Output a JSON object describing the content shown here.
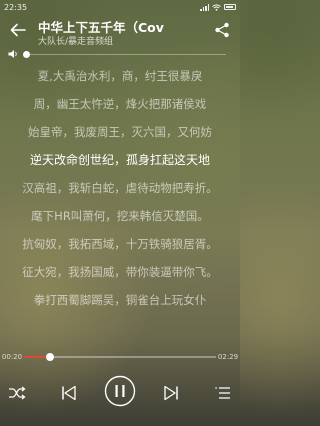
{
  "status": {
    "time": "22:35"
  },
  "header": {
    "title": "中华上下五千年（Cov",
    "artist": "大队长/暴走音频组"
  },
  "volume": {
    "level": 0.0
  },
  "lyrics": [
    "夏,大禹治水利，商，纣王很暴戾",
    "周，幽王太忤逆，烽火把那诸侯戏",
    "始皇帝，我废周王，灭六国，又何妨",
    "逆天改命创世纪，孤身扛起这天地",
    "汉高祖，我斩白蛇，虐待动物把寿折。",
    "麾下HR叫萧何，挖来韩信灭楚国。",
    "抗匈奴，我拓西域，十万铁骑狼居胥。",
    "征大宛，我扬国威，带你装逼带你飞。",
    "拳打西蜀脚踢吴，铜雀台上玩女仆"
  ],
  "current_lyric_index": 3,
  "playback": {
    "elapsed": "00:20",
    "total": "02:29",
    "progress": 0.134
  },
  "colors": {
    "accent": "#e0492e"
  },
  "icons": {
    "back": "back-arrow-icon",
    "share": "share-icon",
    "volume": "volume-icon",
    "shuffle": "shuffle-icon",
    "previous": "previous-icon",
    "pause": "pause-icon",
    "next": "next-icon",
    "playlist": "playlist-icon"
  }
}
